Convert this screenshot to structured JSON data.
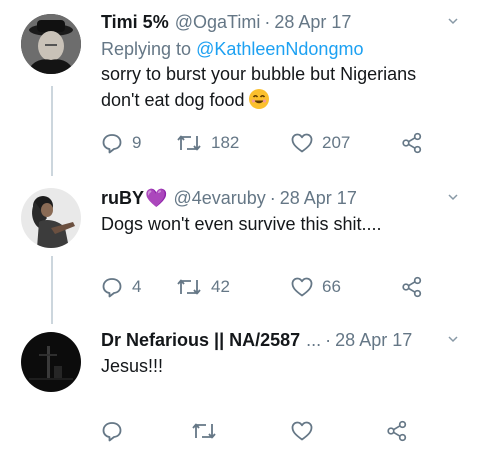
{
  "tweets": [
    {
      "name": "Timi 5%",
      "handle": "@OgaTimi",
      "date": "28 Apr 17",
      "reply_prefix": "Replying to",
      "reply_mention": "@KathleenNdongmo",
      "text_line1": "sorry to burst your bubble but Nigerians",
      "text_line2": "don't eat dog food",
      "emoji": "smiling-face-emoji",
      "replies": "9",
      "retweets": "182",
      "likes": "207"
    },
    {
      "name": "ruBY",
      "name_suffix": "💜",
      "handle": "@4evaruby",
      "date": "28 Apr 17",
      "text_line1": "Dogs won't even survive this shit....",
      "replies": "4",
      "retweets": "42",
      "likes": "66"
    },
    {
      "name": "Dr Nefarious || NA/2587",
      "truncation": "...",
      "date": "28 Apr 17",
      "text_line1": "Jesus!!!"
    }
  ],
  "separator": "·",
  "colors": {
    "secondary": "#657786",
    "link": "#1da1f2",
    "thread_line": "#ccd6dd",
    "purple_heart": "#8a2be2"
  },
  "icons": [
    "reply-icon",
    "retweet-icon",
    "like-icon",
    "share-icon",
    "caret-down-icon"
  ]
}
